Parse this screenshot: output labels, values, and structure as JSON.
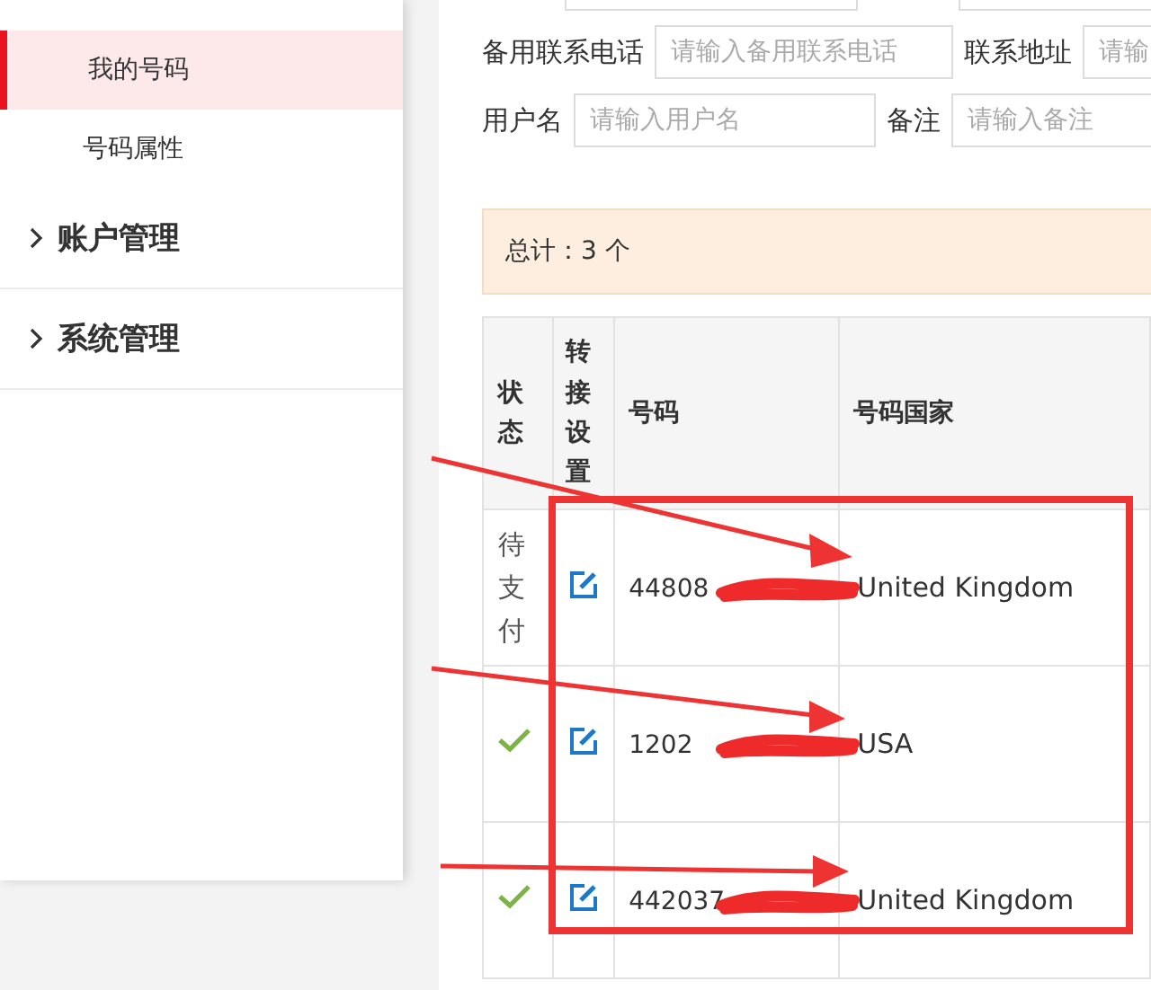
{
  "sidebar": {
    "items": [
      {
        "label": "我的号码",
        "selected": true
      },
      {
        "label": "号码属性",
        "selected": false
      }
    ],
    "groups": [
      {
        "label": "账户管理",
        "expanded": false
      },
      {
        "label": "系统管理",
        "expanded": false
      }
    ]
  },
  "form": {
    "rows": [
      [
        {},
        {}
      ],
      [
        {
          "label": "备用联系电话",
          "placeholder": "请输入备用联系电话"
        },
        {
          "label": "联系地址",
          "placeholder": "请输"
        }
      ],
      [
        {
          "label": "用户名",
          "placeholder": "请输入用户名"
        },
        {
          "label": "备注",
          "placeholder": "请输入备注"
        }
      ]
    ]
  },
  "summary": "总计：3 个",
  "table": {
    "columns": [
      "状态",
      "转接设置",
      "号码",
      "号码国家"
    ],
    "rows": [
      {
        "status": {
          "kind": "text",
          "text": "待支付"
        },
        "number": "44808",
        "country": "United Kingdom"
      },
      {
        "status": {
          "kind": "check"
        },
        "number": "1202",
        "country": "USA"
      },
      {
        "status": {
          "kind": "check"
        },
        "number": "442037",
        "country": "United Kingdom"
      }
    ]
  }
}
